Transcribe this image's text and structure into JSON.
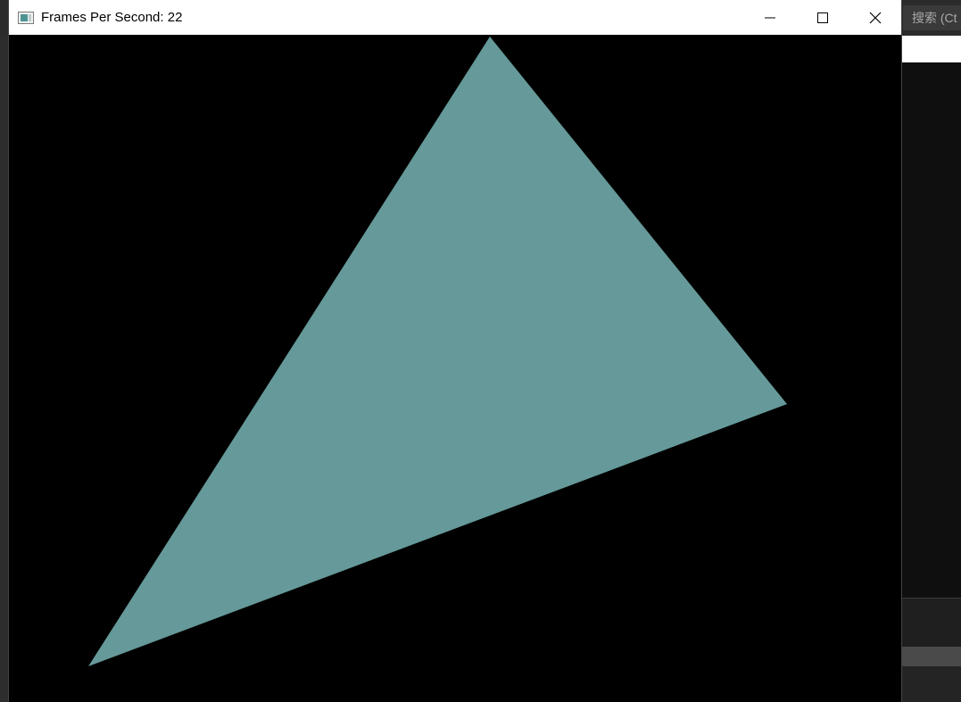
{
  "background_app": {
    "search_placeholder": "搜索 (Ct"
  },
  "window": {
    "title": "Frames Per Second: 22",
    "controls": {
      "minimize_icon": "minimize-icon",
      "maximize_icon": "maximize-icon",
      "close_icon": "close-icon"
    }
  },
  "render": {
    "clear_color": "#000000",
    "triangle_color": "#669999"
  },
  "colors": {
    "titlebar": "#ffffff",
    "accent": "#3d7ad6"
  }
}
